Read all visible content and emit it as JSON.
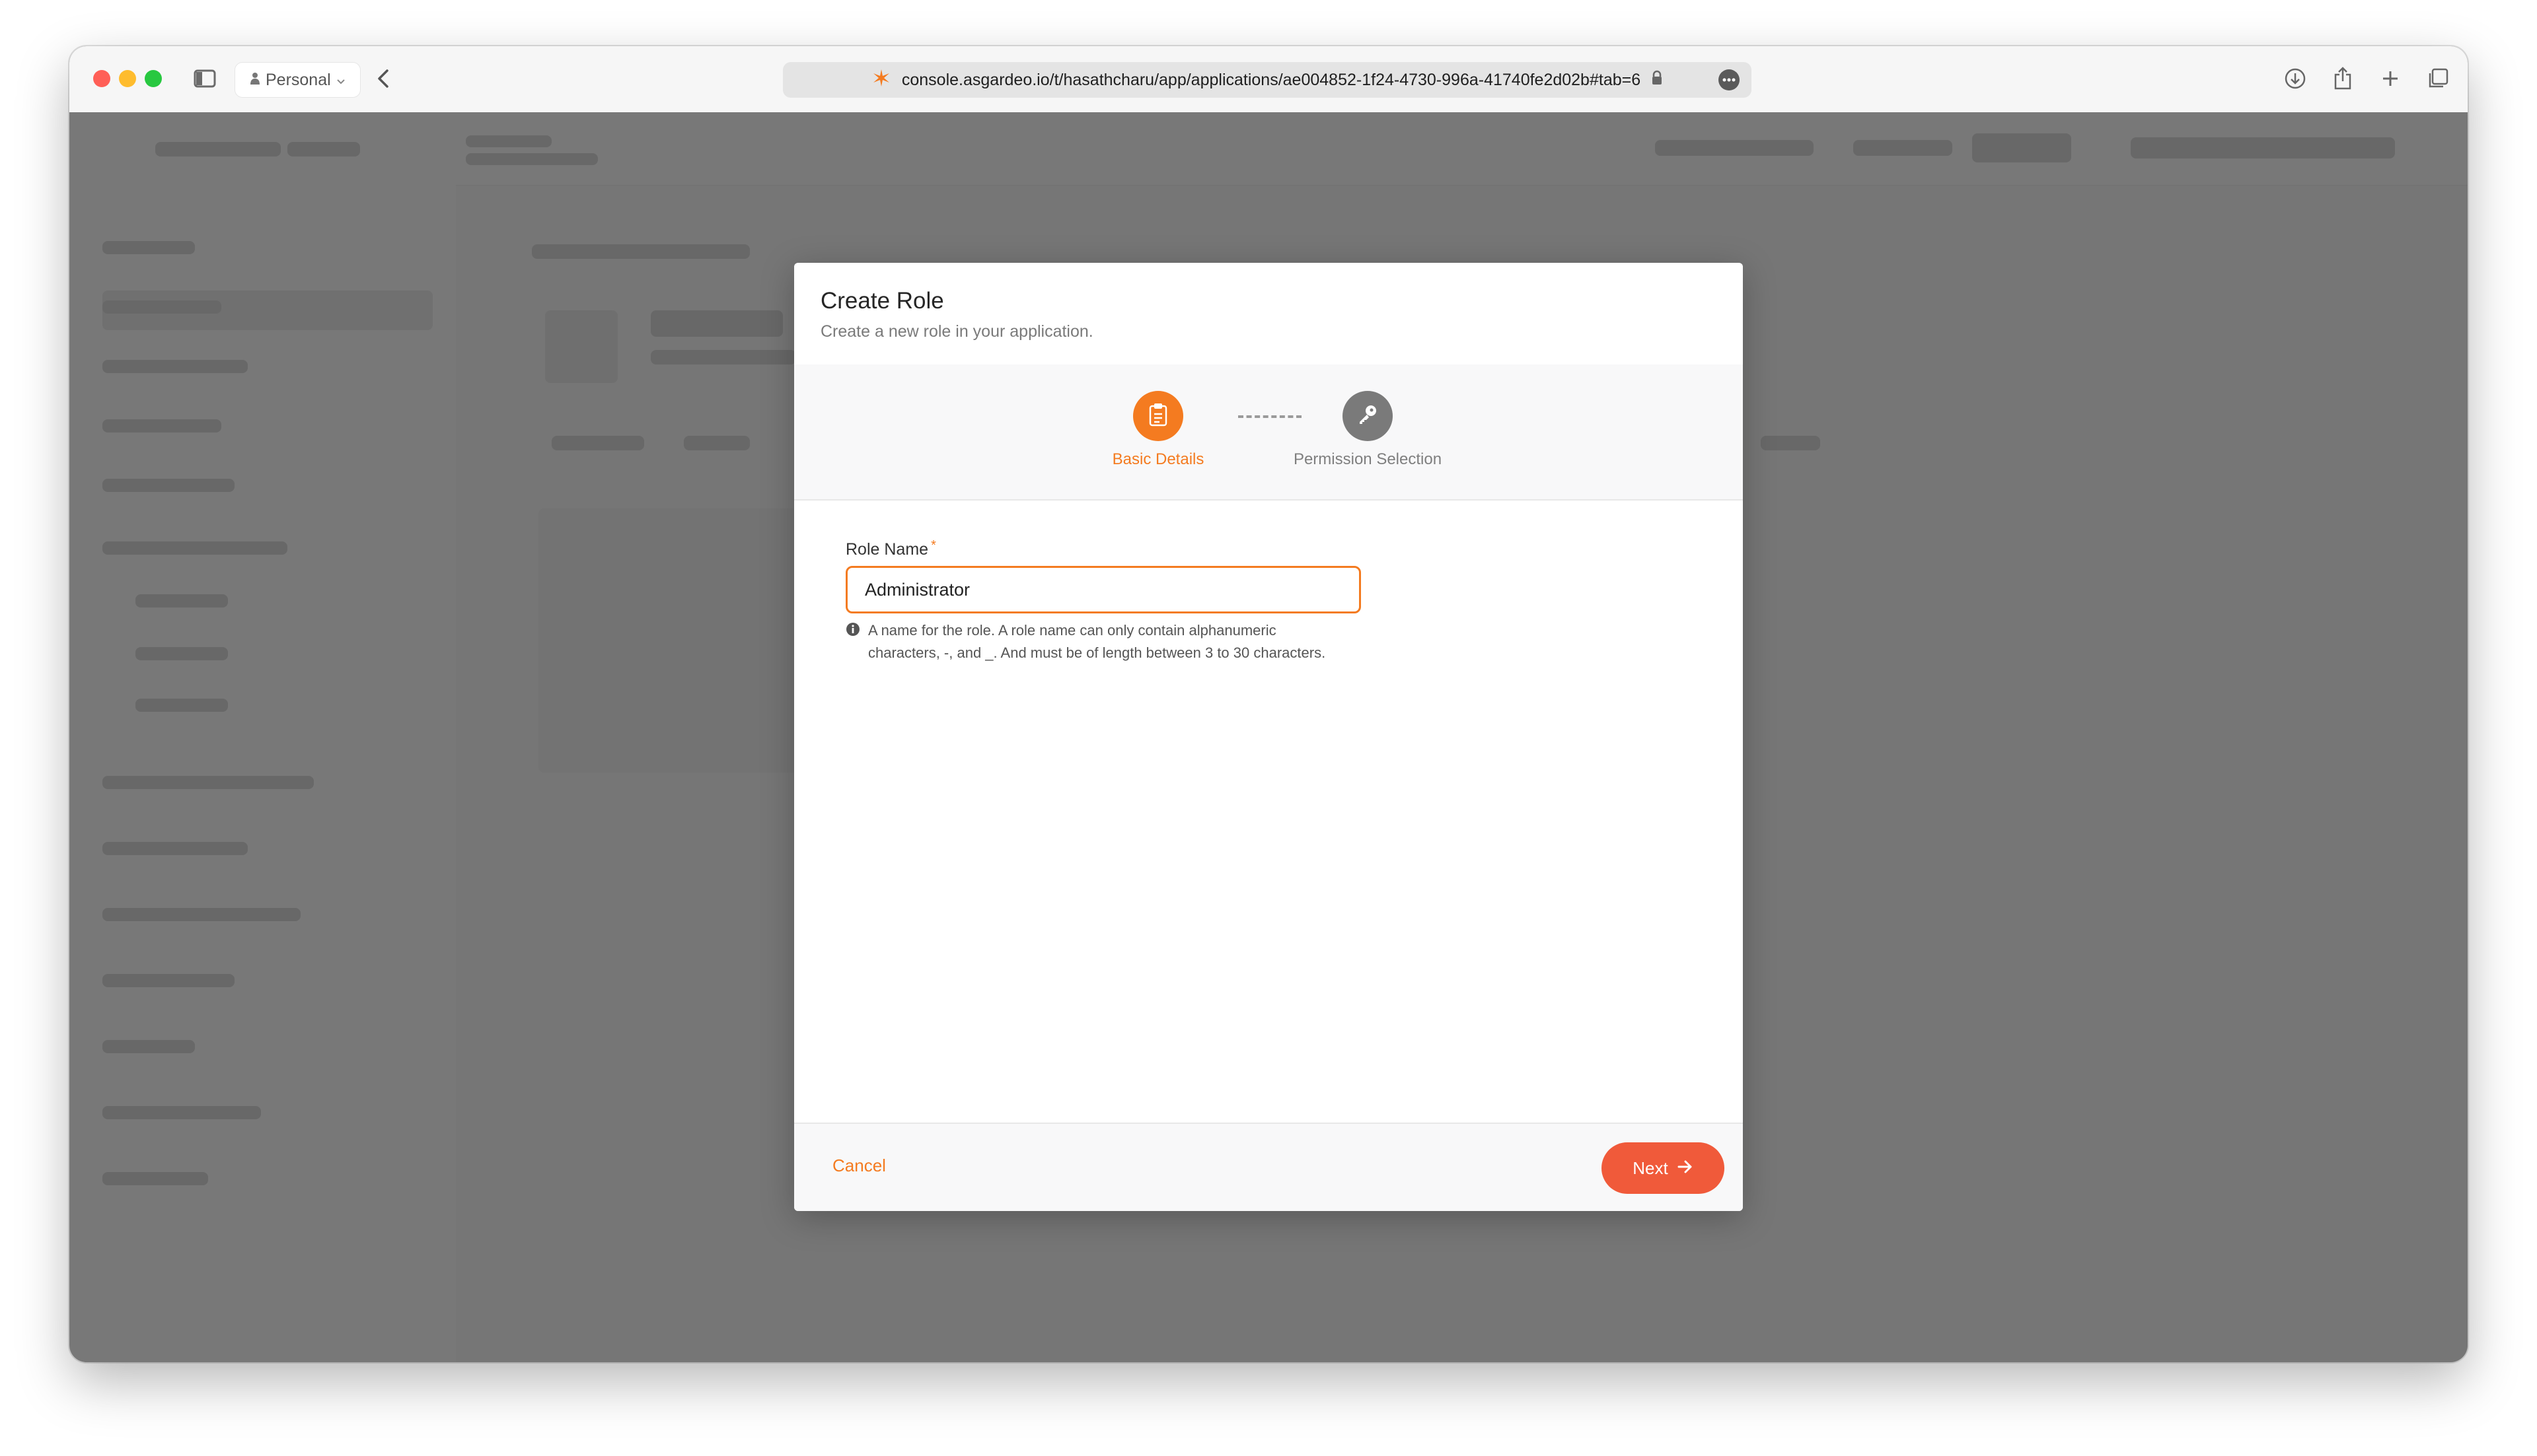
{
  "browser": {
    "profile_label": "Personal",
    "url": "console.asgardeo.io/t/hasathcharu/app/applications/ae004852-1f24-4730-996a-41740fe2d02b#tab=6"
  },
  "modal": {
    "title": "Create Role",
    "subtitle": "Create a new role in your application.",
    "steps": [
      {
        "label": "Basic Details",
        "state": "active",
        "icon": "clipboard-icon"
      },
      {
        "label": "Permission Selection",
        "state": "inactive",
        "icon": "key-icon"
      }
    ],
    "role_name": {
      "label": "Role Name",
      "required_mark": "*",
      "value": "Administrator",
      "hint": "A name for the role. A role name can only contain alphanumeric characters, -, and _. And must be of length between 3 to 30 characters."
    },
    "footer": {
      "cancel_label": "Cancel",
      "next_label": "Next"
    }
  },
  "colors": {
    "accent": "#f47b20",
    "next_button": "#f05a3a",
    "inactive_step": "#7a7a7a"
  }
}
